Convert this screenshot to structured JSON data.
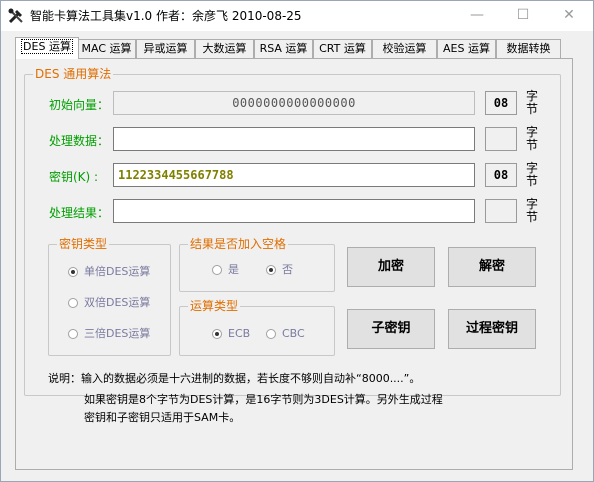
{
  "window": {
    "title": "智能卡算法工具集v1.0  作者：余彦飞  2010-08-25",
    "minimize_glyph": "—",
    "maximize_glyph": "☐",
    "close_glyph": "✕"
  },
  "tabs": [
    {
      "label": "DES 运算",
      "active": true
    },
    {
      "label": "MAC 运算"
    },
    {
      "label": "异或运算"
    },
    {
      "label": "大数运算"
    },
    {
      "label": "RSA 运算"
    },
    {
      "label": "CRT 运算"
    },
    {
      "label": "校验运算"
    },
    {
      "label": "AES 运算"
    },
    {
      "label": "数据转换"
    }
  ],
  "des": {
    "group_title": "DES 通用算法",
    "rows": {
      "iv": {
        "label": "初始向量：",
        "value": "0000000000000000",
        "count": "08"
      },
      "data": {
        "label": "处理数据：",
        "value": "",
        "count": ""
      },
      "key": {
        "label": "密钥(K) :",
        "value": "1122334455667788",
        "count": "08"
      },
      "result": {
        "label": "处理结果：",
        "value": "",
        "count": ""
      }
    },
    "unit_label_top": "字",
    "unit_label_bottom": "节"
  },
  "key_type": {
    "title": "密钥类型",
    "options": [
      "单倍DES运算",
      "双倍DES运算",
      "三倍DES运算"
    ],
    "selected": "单倍DES运算"
  },
  "add_space": {
    "title": "结果是否加入空格",
    "options": [
      "是",
      "否"
    ],
    "selected": "否"
  },
  "op_type": {
    "title": "运算类型",
    "options": [
      "ECB",
      "CBC"
    ],
    "selected": "ECB"
  },
  "buttons": {
    "encrypt": "加密",
    "decrypt": "解密",
    "subkey": "子密钥",
    "process_key": "过程密钥"
  },
  "note": {
    "line1": "说明：输入的数据必须是十六进制的数据，若长度不够则自动补“8000....”。",
    "line2": "如果密钥是8个字节为DES计算，是16字节则为3DES计算。另外生成过程",
    "line3": "密钥和子密钥只适用于SAM卡。"
  },
  "colors": {
    "label_green": "#00a000",
    "group_title_orange": "#e06e00",
    "key_text_olive": "#808000"
  }
}
